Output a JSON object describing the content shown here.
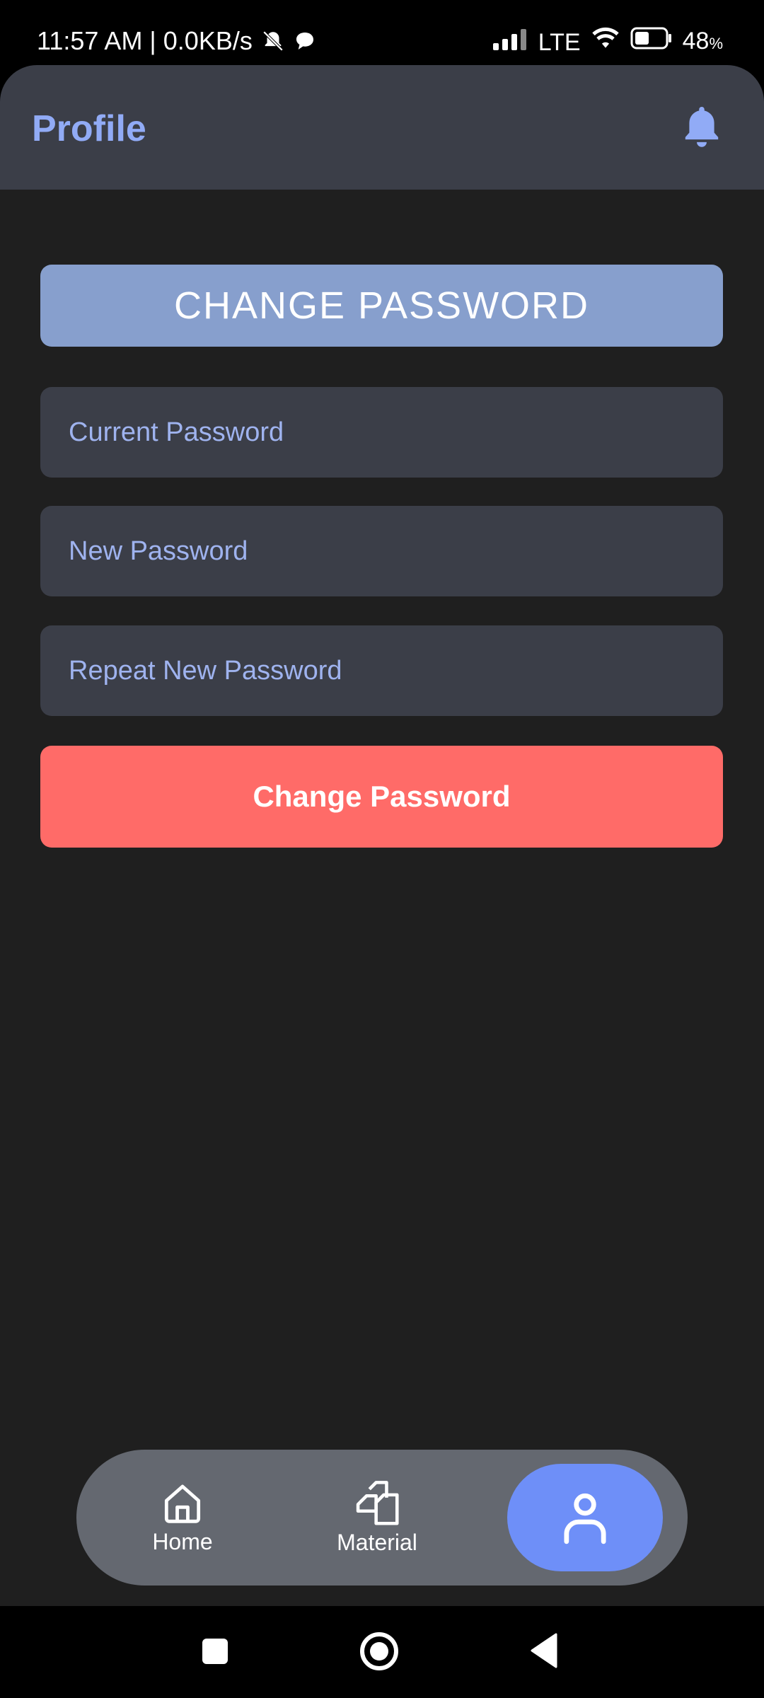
{
  "status_bar": {
    "time_speed": "11:57 AM | 0.0KB/s",
    "network": "LTE",
    "battery_value": "48",
    "battery_unit": "%",
    "battery_level": 0.48
  },
  "app_bar": {
    "title": "Profile",
    "bell_icon": "bell-icon"
  },
  "section": {
    "header": "CHANGE PASSWORD"
  },
  "form": {
    "current_password_placeholder": "Current Password",
    "new_password_placeholder": "New Password",
    "repeat_password_placeholder": "Repeat New Password",
    "submit_label": "Change Password"
  },
  "bottom_nav": {
    "items": [
      {
        "label": "Home",
        "icon": "home-icon"
      },
      {
        "label": "Material",
        "icon": "documents-icon"
      },
      {
        "label": "",
        "icon": "user-icon",
        "active": true
      }
    ]
  },
  "colors": {
    "accent": "#91abf6",
    "header_band": "#879fcd",
    "danger_button": "#ff6b68",
    "surface": "#3b3e48",
    "background": "#1f1f1f",
    "nav_bar": "#646870",
    "nav_active": "#6e8ff8"
  }
}
